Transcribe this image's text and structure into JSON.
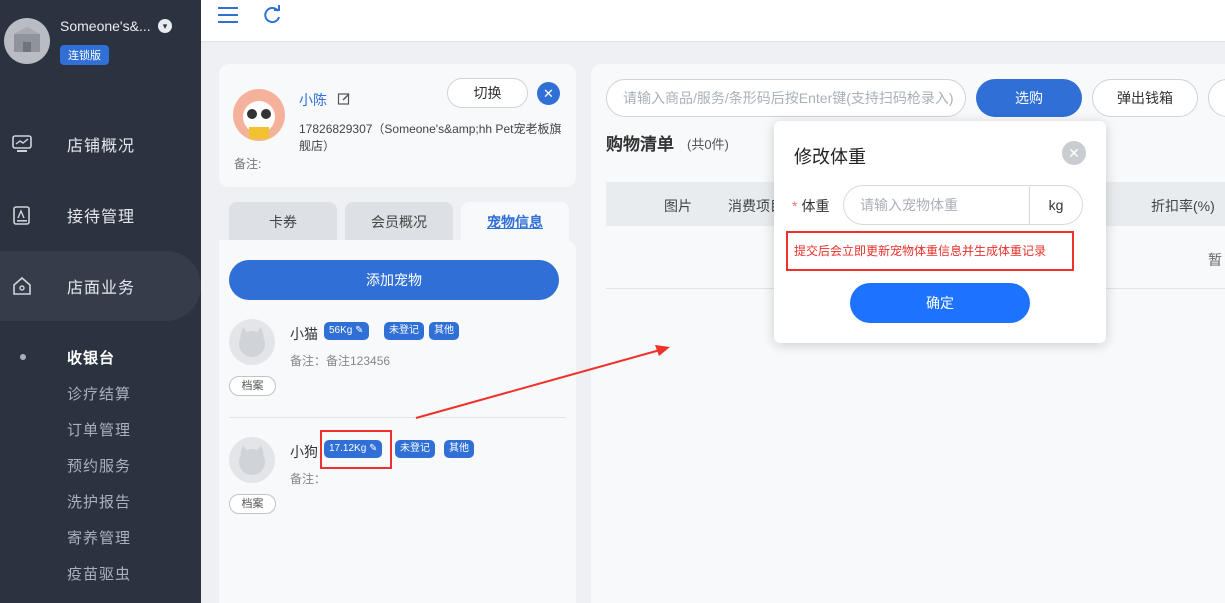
{
  "sidebar": {
    "store_name": "Someone's&...",
    "store_badge": "连锁版",
    "menu": [
      {
        "label": "店铺概况",
        "icon": "monitor-icon"
      },
      {
        "label": "接待管理",
        "icon": "clipboard-icon"
      },
      {
        "label": "店面业务",
        "icon": "home-icon"
      }
    ],
    "submenu": [
      "收银台",
      "诊疗结算",
      "订单管理",
      "预约服务",
      "洗护报告",
      "寄养管理",
      "疫苗驱虫"
    ]
  },
  "topbar": {
    "menu_icon": "hamburger-icon",
    "refresh_icon": "refresh-icon"
  },
  "member": {
    "name": "小陈",
    "switch_label": "切换",
    "close_glyph": "✕",
    "phone_store": "17826829307（Someone's&amp;hh Pet宠老板旗舰店）",
    "note": "备注:"
  },
  "tabs": [
    "卡券",
    "会员概况",
    "宠物信息"
  ],
  "pets": {
    "add_label": "添加宠物",
    "file_label": "档案",
    "items": [
      {
        "name": "小猫",
        "weight": "56Kg",
        "status": "未登记",
        "type": "其他",
        "note": "备注：备注123456"
      },
      {
        "name": "小狗",
        "weight": "17.12Kg",
        "status": "未登记",
        "type": "其他",
        "note": "备注："
      }
    ]
  },
  "shop": {
    "search_placeholder": "请输入商品/服务/条形码后按Enter键(支持扫码枪录入)",
    "pick_label": "选购",
    "drawer_label": "弹出钱箱",
    "cart_title": "购物清单",
    "cart_count": "(共0件)",
    "columns": [
      "图片",
      "消费项目",
      "折扣率(%)"
    ],
    "empty_text": "暂"
  },
  "modal": {
    "title": "修改体重",
    "close_glyph": "✕",
    "required_mark": "*",
    "field_label": "体重",
    "field_placeholder": "请输入宠物体重",
    "unit": "kg",
    "tip": "提交后会立即更新宠物体重信息并生成体重记录",
    "confirm_label": "确定"
  },
  "colors": {
    "sidebar_bg": "#2b3340",
    "primary": "#2f6fd6",
    "confirm": "#1d73ff",
    "annotation": "#f0302a"
  }
}
